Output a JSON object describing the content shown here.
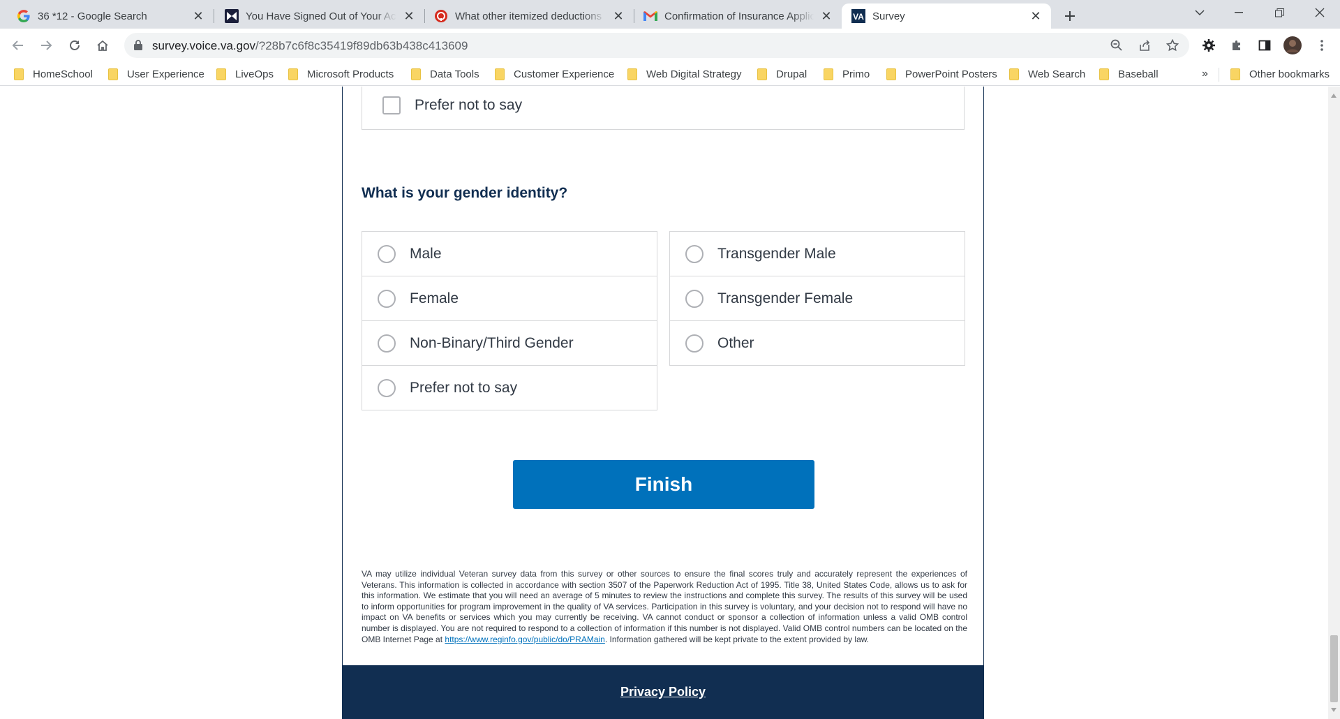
{
  "browser": {
    "tabs": [
      {
        "title": "36 *12 - Google Search",
        "icon": "google-icon"
      },
      {
        "title": "You Have Signed Out of Your Account",
        "icon": "signout-icon"
      },
      {
        "title": "What other itemized deductions",
        "icon": "help-icon"
      },
      {
        "title": "Confirmation of Insurance Application",
        "icon": "gmail-icon"
      },
      {
        "title": "Survey",
        "icon": "va-icon",
        "active": true
      }
    ],
    "url_host": "survey.voice.va.gov",
    "url_path": "/?28b7c6f8c35419f89db63b438c413609",
    "va_badge": "VA"
  },
  "bookmarks": {
    "items": [
      "HomeSchool",
      "User Experience",
      "LiveOps",
      "Microsoft Products",
      "Data Tools",
      "Customer Experience",
      "Web Digital Strategy",
      "Drupal",
      "Primo",
      "PowerPoint Posters",
      "Web Search",
      "Baseball"
    ],
    "more": "»",
    "other": "Other bookmarks"
  },
  "survey": {
    "prev_option": "Prefer not to say",
    "question": "What is your gender identity?",
    "left_options": [
      "Male",
      "Female",
      "Non-Binary/Third Gender",
      "Prefer not to say"
    ],
    "right_options": [
      "Transgender Male",
      "Transgender Female",
      "Other"
    ],
    "finish_label": "Finish",
    "disclaimer_text": "VA may utilize individual Veteran survey data from this survey or other sources to ensure the final scores truly and accurately represent the experiences of Veterans. This information is collected in accordance with section 3507 of the Paperwork Reduction Act of 1995. Title 38, United States Code, allows us to ask for this information. We estimate that you will need an average of 5 minutes to review the instructions and complete this survey. The results of this survey will be used to inform opportunities for program improvement in the quality of VA services. Participation in this survey is voluntary, and your decision not to respond will have no impact on VA benefits or services which you may currently be receiving. VA cannot conduct or sponsor a collection of information unless a valid OMB control number is displayed. You are not required to respond to a collection of information if this number is not displayed. Valid OMB control numbers can be located on the OMB Internet Page at",
    "disclaimer_link": "https://www.reginfo.gov/public/do/PRAMain",
    "disclaimer_tail": ". Information gathered will be kept private to the extent provided by law.",
    "privacy_label": "Privacy Policy"
  },
  "colors": {
    "navy": "#112e51",
    "button_blue": "#0071bb",
    "border_gray": "#d6d7d9"
  }
}
